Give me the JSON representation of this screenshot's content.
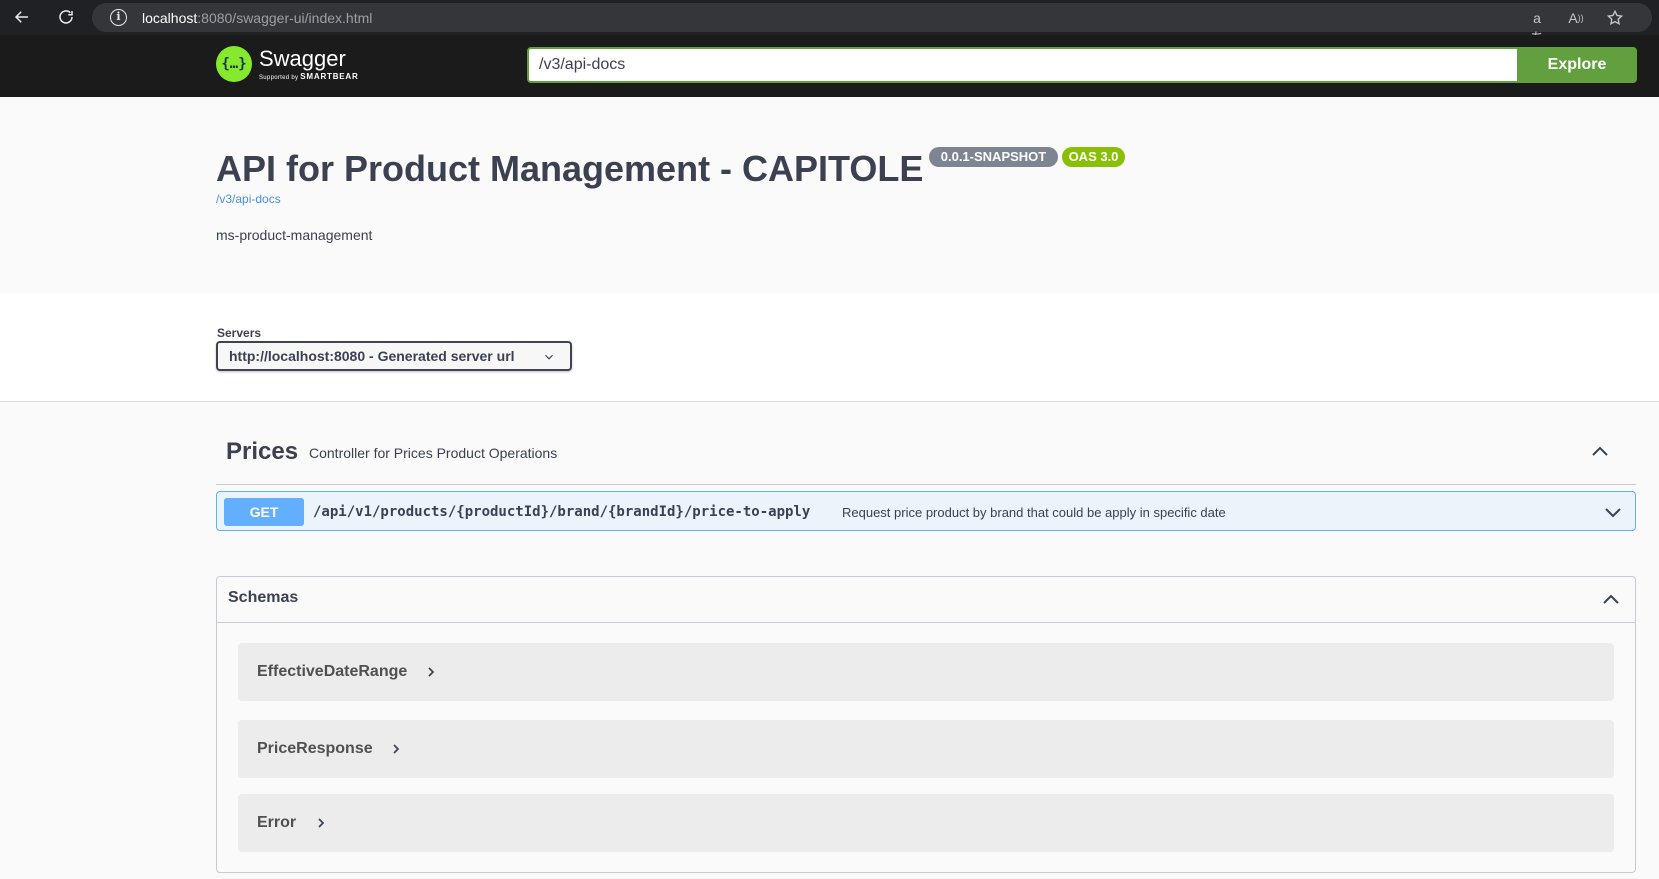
{
  "browser": {
    "url_host": "localhost",
    "url_rest": ":8080/swagger-ui/index.html",
    "icons": [
      "back-arrow-icon",
      "reload-icon",
      "site-info-icon",
      "translate-icon",
      "read-aloud-icon",
      "favorite-star-icon"
    ]
  },
  "topbar": {
    "logo_title": "Swagger",
    "logo_sub_prefix": "Supported by ",
    "logo_sub_brand": "SMARTBEAR",
    "logo_glyph": "{…}",
    "spec_url_value": "/v3/api-docs",
    "explore_label": "Explore",
    "colors": {
      "accent": "#62a03f",
      "bar": "#1b1b1b",
      "logo": "#85ea2d"
    }
  },
  "info": {
    "title": "API for Product Management - CAPITOLE",
    "version_badge": "0.0.1-SNAPSHOT",
    "oas_badge": "OAS 3.0",
    "spec_link": "/v3/api-docs",
    "description": "ms-product-management"
  },
  "servers": {
    "label": "Servers",
    "selected": "http://localhost:8080 - Generated server url"
  },
  "tags": [
    {
      "name": "Prices",
      "description": "Controller for Prices Product Operations",
      "expanded": true,
      "operations": [
        {
          "method": "GET",
          "path": "/api/v1/products/{productId}/brand/{brandId}/price-to-apply",
          "summary": "Request price product by brand that could be apply in specific date",
          "color": "#61affe"
        }
      ]
    }
  ],
  "schemas": {
    "title": "Schemas",
    "expanded": true,
    "models": [
      {
        "name": "EffectiveDateRange"
      },
      {
        "name": "PriceResponse"
      },
      {
        "name": "Error"
      }
    ]
  }
}
